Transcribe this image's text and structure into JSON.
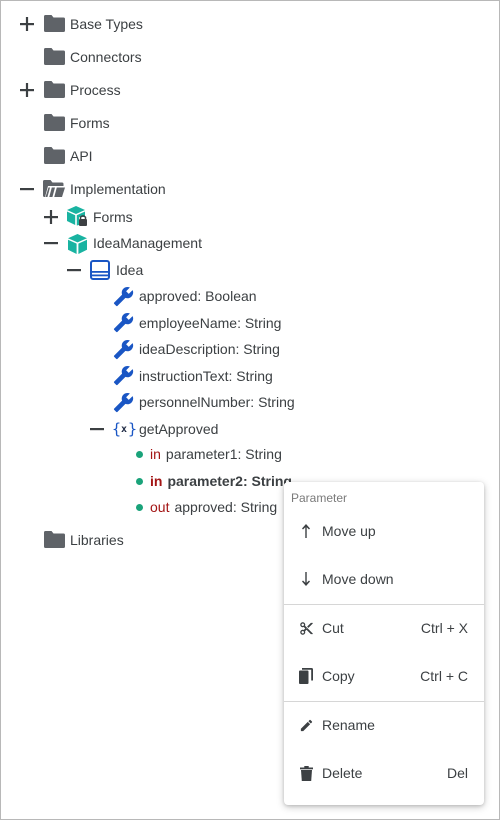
{
  "tree": {
    "base_types": "Base Types",
    "connectors": "Connectors",
    "process": "Process",
    "forms": "Forms",
    "api": "API",
    "implementation": "Implementation",
    "impl_forms": "Forms",
    "idea_management": "IdeaManagement",
    "idea": "Idea",
    "attributes": [
      {
        "name": "approved",
        "type": ": Boolean"
      },
      {
        "name": "employeeName",
        "type": ": String"
      },
      {
        "name": "ideaDescription",
        "type": ": String"
      },
      {
        "name": "instructionText",
        "type": ": String"
      },
      {
        "name": "personnelNumber",
        "type": ": String"
      }
    ],
    "method": "getApproved",
    "params": [
      {
        "dir": "in",
        "text": "parameter1: String"
      },
      {
        "dir": "in",
        "text": "parameter2: String"
      },
      {
        "dir": "out",
        "text": "approved: String"
      }
    ],
    "libraries": "Libraries"
  },
  "menu": {
    "header": "Parameter",
    "move_up": "Move up",
    "move_down": "Move down",
    "cut": "Cut",
    "cut_shortcut": "Ctrl + X",
    "copy": "Copy",
    "copy_shortcut": "Ctrl + C",
    "rename": "Rename",
    "delete": "Delete",
    "delete_shortcut": "Del"
  },
  "colors": {
    "folder": "#5f6368",
    "cube": "#19b3a1",
    "wrench": "#1a56c4",
    "keyword": "#a31515",
    "dot": "#1aa37a"
  }
}
